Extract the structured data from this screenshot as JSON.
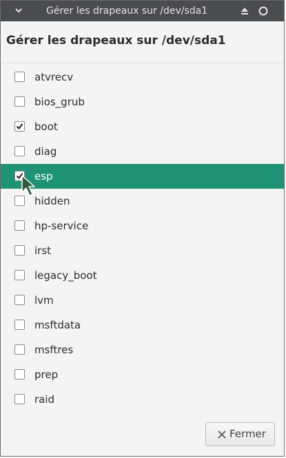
{
  "window": {
    "title": "Gérer les drapeaux sur /dev/sda1",
    "heading": "Gérer les drapeaux sur /dev/sda1"
  },
  "flags": [
    {
      "label": "atvrecv",
      "checked": false
    },
    {
      "label": "bios_grub",
      "checked": false
    },
    {
      "label": "boot",
      "checked": true
    },
    {
      "label": "diag",
      "checked": false
    },
    {
      "label": "esp",
      "checked": true
    },
    {
      "label": "hidden",
      "checked": false
    },
    {
      "label": "hp-service",
      "checked": false
    },
    {
      "label": "irst",
      "checked": false
    },
    {
      "label": "legacy_boot",
      "checked": false
    },
    {
      "label": "lvm",
      "checked": false
    },
    {
      "label": "msftdata",
      "checked": false
    },
    {
      "label": "msftres",
      "checked": false
    },
    {
      "label": "prep",
      "checked": false
    },
    {
      "label": "raid",
      "checked": false
    }
  ],
  "selected_flag": "esp",
  "buttons": {
    "close_label": "Fermer",
    "close_icon": "close-icon"
  },
  "colors": {
    "selection": "#1f9376",
    "titlebar": "#4a4d50"
  }
}
